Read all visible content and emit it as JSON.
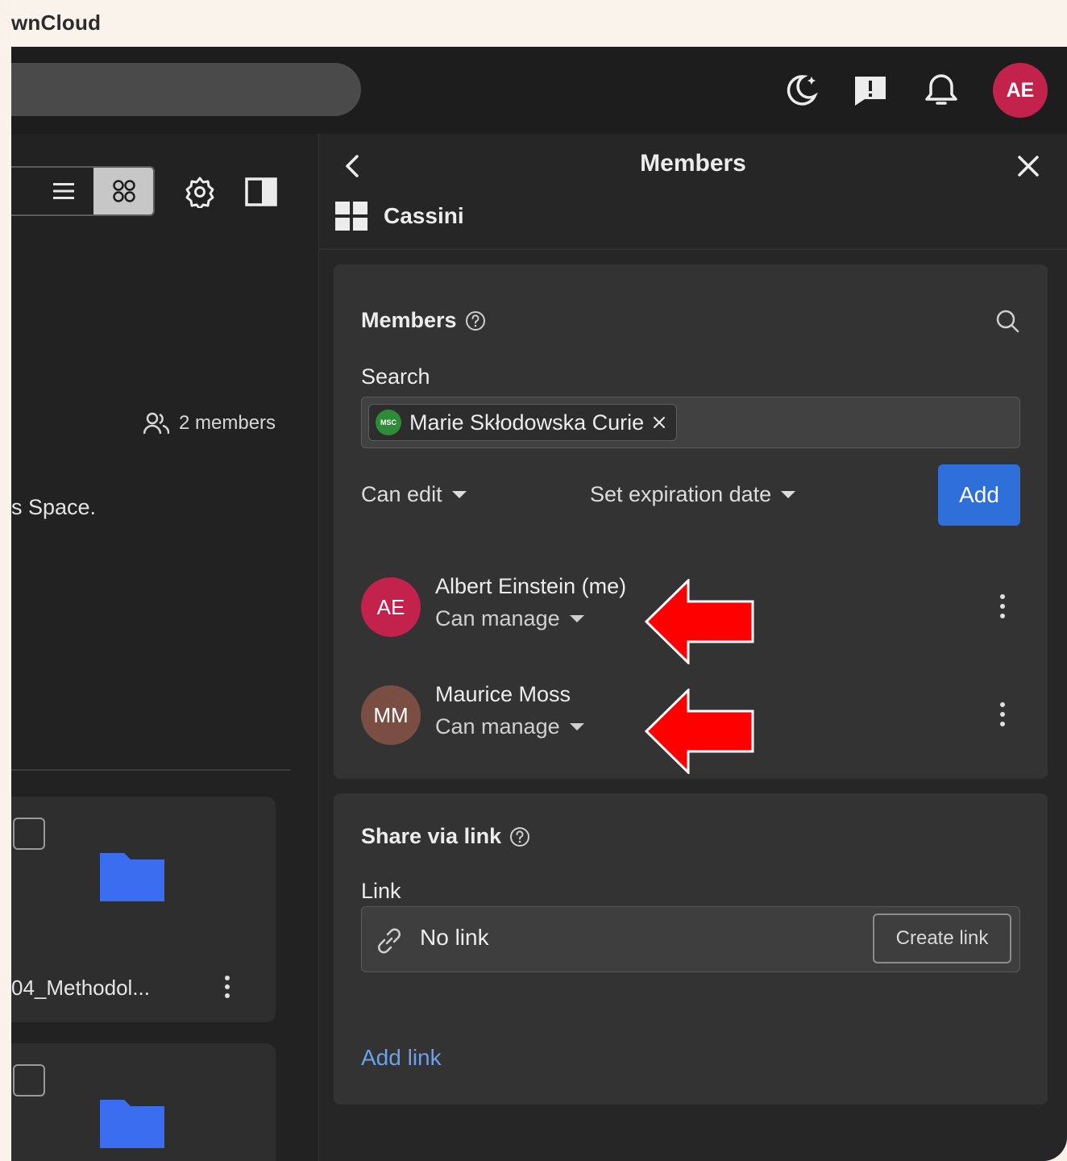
{
  "window": {
    "title": "wnCloud"
  },
  "topbar": {
    "icons": [
      "theme-moon-icon",
      "feedback-icon",
      "bell-icon"
    ],
    "avatar_initials": "AE",
    "avatar_color": "#c2224b"
  },
  "left": {
    "members_count": "2 members",
    "space_description": "s Space.",
    "cards": [
      {
        "name": "04_Methodol..."
      },
      {
        "name": ""
      }
    ],
    "folder_color": "#3a6df0"
  },
  "sidebar": {
    "title": "Members",
    "space_name": "Cassini",
    "members_section": {
      "title": "Members",
      "search_label": "Search",
      "selected_chip": {
        "initials": "MSC",
        "name": "Marie Skłodowska Curie",
        "avatar_color": "#2e8b37"
      },
      "permission_dropdown": "Can edit",
      "expiration_dropdown": "Set expiration date",
      "add_button": "Add",
      "members": [
        {
          "initials": "AE",
          "name": "Albert Einstein (me)",
          "role": "Can manage",
          "avatar_color": "#c2224b"
        },
        {
          "initials": "MM",
          "name": "Maurice Moss",
          "role": "Can manage",
          "avatar_color": "#7a4e43"
        }
      ]
    },
    "share_section": {
      "title": "Share via link",
      "link_label": "Link",
      "no_link_text": "No link",
      "create_link_button": "Create link",
      "add_link": "Add link"
    }
  },
  "annotation": {
    "arrow_color": "#ff0000"
  }
}
